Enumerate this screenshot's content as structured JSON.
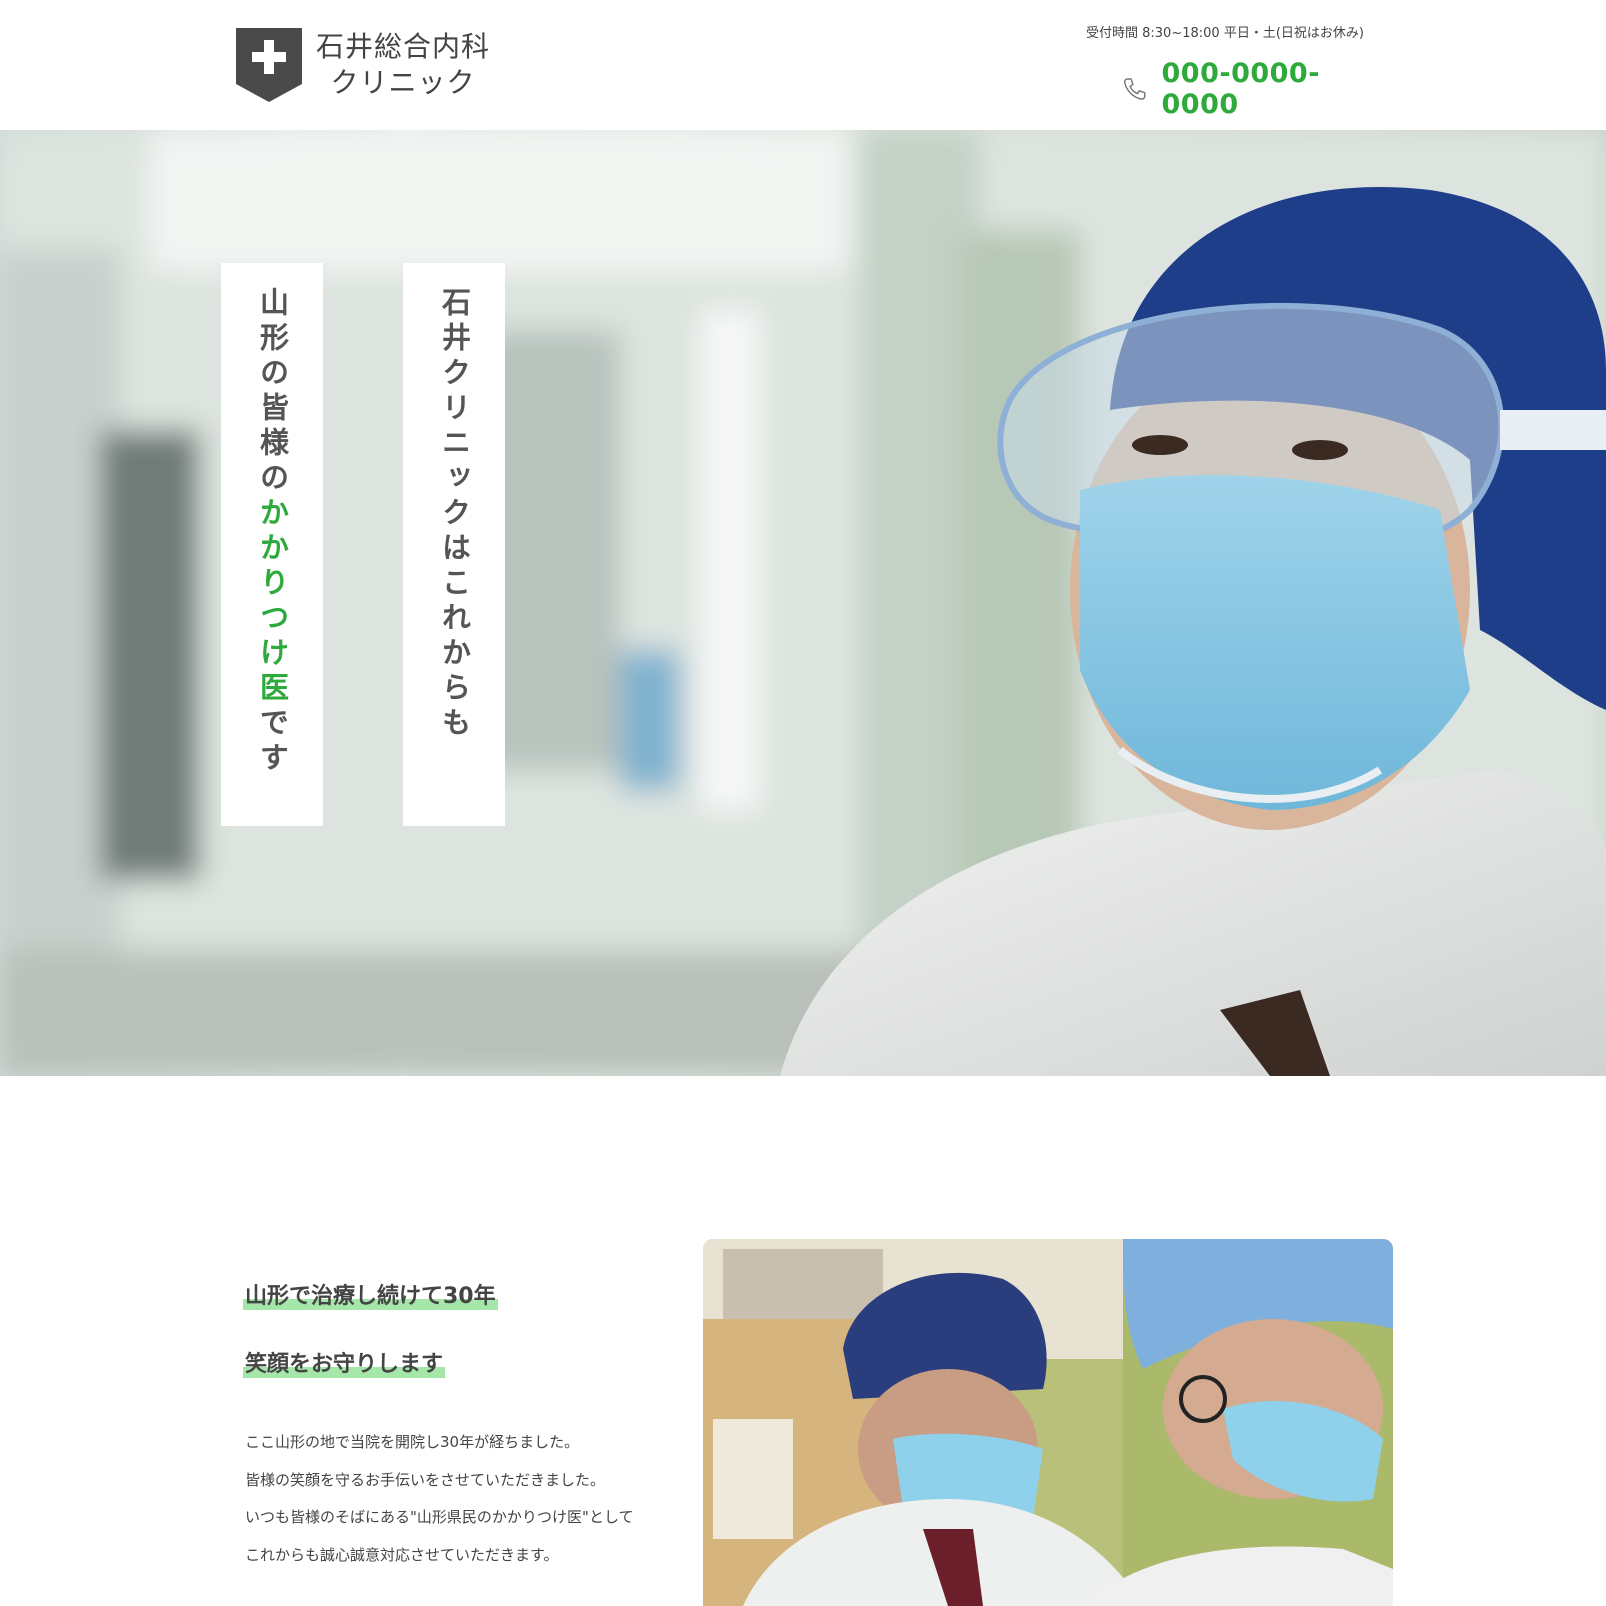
{
  "header": {
    "logo_line1": "石井総合内科",
    "logo_line2": "クリニック",
    "hours": "受付時間 8:30~18:00 平日・土(日祝はお休み)",
    "phone": "000-0000-0000"
  },
  "hero": {
    "catch_right": "石井クリニックはこれからも",
    "catch_left_before": "山形の皆様の",
    "catch_left_highlight": "かかりつけ医",
    "catch_left_after": "です"
  },
  "intro": {
    "headline1": "山形で治療し続けて30年",
    "headline2": "笑顔をお守りします",
    "paragraphs": [
      "ここ山形の地で当院を開院し30年が経ちました。",
      "皆様の笑顔を守るお手伝いをさせていただきました。",
      "いつも皆様のそばにある\"山形県民のかかりつけ医\"として",
      "これからも誠心誠意対応させていただきます。"
    ]
  },
  "colors": {
    "accent_green": "#2eaa3c",
    "highlight_green": "#a5e6a9",
    "logo_gray": "#4a4a4a"
  },
  "icons": {
    "logo": "medical-cross-shield-icon",
    "phone": "phone-icon"
  }
}
